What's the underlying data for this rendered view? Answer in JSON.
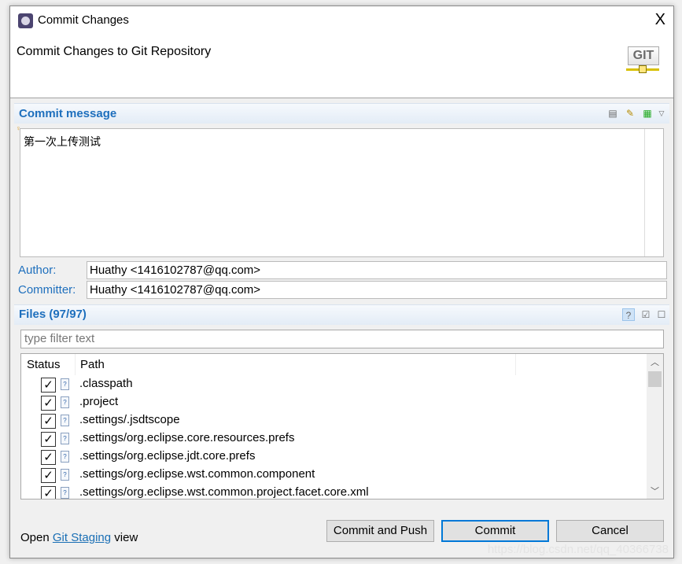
{
  "window": {
    "title": "Commit Changes",
    "close_label": "X"
  },
  "banner": {
    "title": "Commit Changes to Git Repository",
    "logo_text": "GIT"
  },
  "commit_message": {
    "title": "Commit message",
    "value": "第一次上传测试"
  },
  "author": {
    "label": "Author:",
    "value": "Huathy <1416102787@qq.com>"
  },
  "committer": {
    "label": "Committer:",
    "value": "Huathy <1416102787@qq.com>"
  },
  "files": {
    "title": "Files (97/97)",
    "filter_placeholder": "type filter text",
    "columns": [
      "Status",
      "Path"
    ],
    "rows": [
      {
        "path": ".classpath",
        "checked": true,
        "icon": "xml-file-icon"
      },
      {
        "path": ".project",
        "checked": true,
        "icon": "xml-file-icon"
      },
      {
        "path": ".settings/.jsdtscope",
        "checked": true,
        "icon": "xml-file-icon"
      },
      {
        "path": ".settings/org.eclipse.core.resources.prefs",
        "checked": true,
        "icon": "text-file-icon"
      },
      {
        "path": ".settings/org.eclipse.jdt.core.prefs",
        "checked": true,
        "icon": "text-file-icon"
      },
      {
        "path": ".settings/org.eclipse.wst.common.component",
        "checked": true,
        "icon": "xml-file-icon"
      },
      {
        "path": ".settings/org.eclipse.wst.common.project.facet.core.xml",
        "checked": true,
        "icon": "xml-file-icon"
      }
    ]
  },
  "footer": {
    "open": "Open",
    "link": "Git Staging",
    "view": "view"
  },
  "buttons": {
    "commit_push": "Commit and Push",
    "commit": "Commit",
    "cancel": "Cancel"
  },
  "watermark": "https://blog.csdn.net/qq_40366738",
  "colors": {
    "accent": "#1e6fbd",
    "default_button_border": "#0078d7"
  }
}
